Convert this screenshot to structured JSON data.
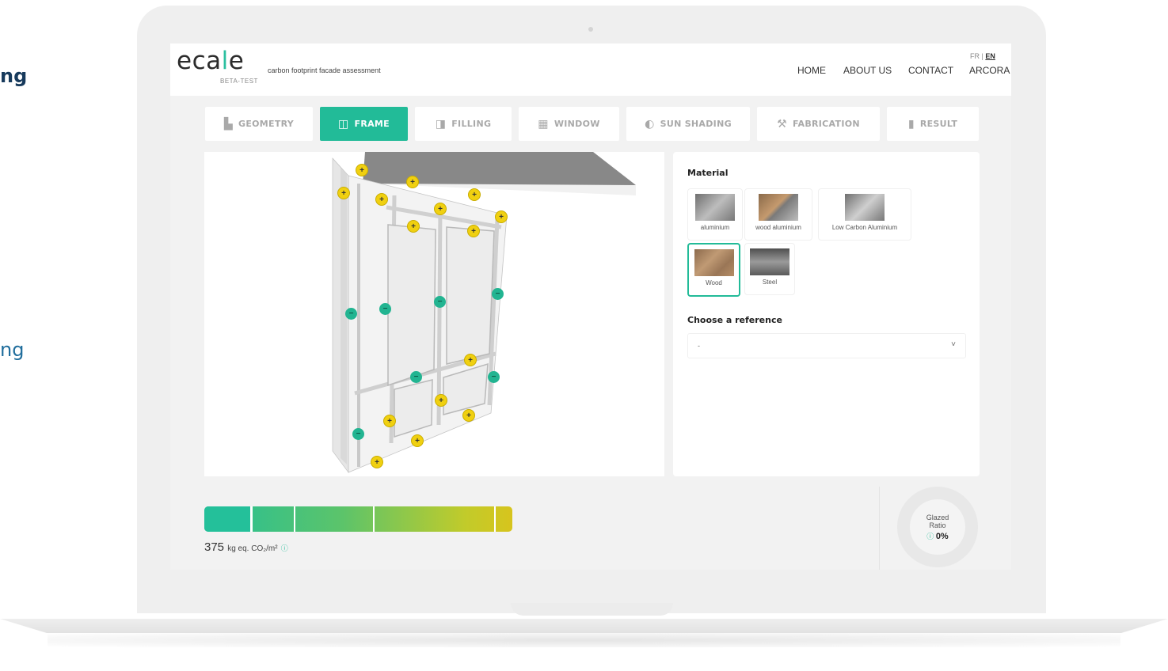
{
  "background_text": [
    "ng",
    "ng"
  ],
  "app": {
    "logo_prefix": "eca",
    "logo_l": "l",
    "logo_suffix": "e",
    "beta_label": "BETA-TEST",
    "tagline": "carbon footprint facade assessment"
  },
  "nav": {
    "home": "HOME",
    "about": "ABOUT US",
    "contact": "CONTACT",
    "arcora": "ARCORA",
    "lang_fr": "FR",
    "lang_sep": "|",
    "lang_en": "EN"
  },
  "tabs": [
    {
      "label": "GEOMETRY",
      "icon": "geometry-icon",
      "active": false
    },
    {
      "label": "FRAME",
      "icon": "frame-icon",
      "active": true
    },
    {
      "label": "FILLING",
      "icon": "filling-icon",
      "active": false
    },
    {
      "label": "WINDOW",
      "icon": "window-icon",
      "active": false
    },
    {
      "label": "SUN SHADING",
      "icon": "sun-shading-icon",
      "active": false
    },
    {
      "label": "FABRICATION",
      "icon": "fabrication-icon",
      "active": false
    },
    {
      "label": "RESULT",
      "icon": "result-icon",
      "active": false
    }
  ],
  "panel": {
    "material_title": "Material",
    "materials": [
      {
        "label": "aluminium",
        "selected": false
      },
      {
        "label": "wood aluminium",
        "selected": false
      },
      {
        "label": "Low Carbon Aluminium",
        "selected": false
      },
      {
        "label": "Wood",
        "selected": true
      },
      {
        "label": "Steel",
        "selected": false
      }
    ],
    "reference_title": "Choose a reference",
    "reference_value": "-",
    "chevron": "˅"
  },
  "footprint": {
    "value": "375",
    "unit": "kg eq. CO₂/m²",
    "help_icon": "help-icon",
    "level_fraction": 0.15
  },
  "glazed": {
    "label_line1": "Glazed",
    "label_line2": "Ratio",
    "value": "0%"
  },
  "colors": {
    "accent": "#22bb98",
    "plus_marker": "#f0d010",
    "minus_marker": "#22b491"
  }
}
